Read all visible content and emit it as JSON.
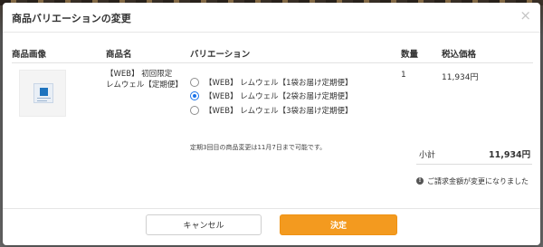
{
  "modal": {
    "title": "商品バリエーションの変更",
    "close": "×"
  },
  "table": {
    "headers": {
      "image": "商品画像",
      "name": "商品名",
      "variation": "バリエーション",
      "quantity": "数量",
      "price": "税込価格"
    },
    "row": {
      "product_name_line1": "【WEB】 初回限定",
      "product_name_line2": "レムウェル【定期便】",
      "variations": [
        {
          "label": "【WEB】 レムウェル【1袋お届け定期便】",
          "selected": false
        },
        {
          "label": "【WEB】 レムウェル【2袋お届け定期便】",
          "selected": true
        },
        {
          "label": "【WEB】 レムウェル【3袋お届け定期便】",
          "selected": false
        }
      ],
      "quantity": "1",
      "price": "11,934円"
    }
  },
  "note": "定期3回目の商品変更は11月7日まで可能です。",
  "summary": {
    "subtotal_label": "小計",
    "subtotal_value": "11,934円",
    "warning_icon": "!",
    "warning_text": "ご請求金額が変更になりました"
  },
  "buttons": {
    "cancel": "キャンセル",
    "confirm": "決定"
  },
  "colors": {
    "accent": "#f39a1f",
    "radio_selected": "#1a73e8"
  }
}
